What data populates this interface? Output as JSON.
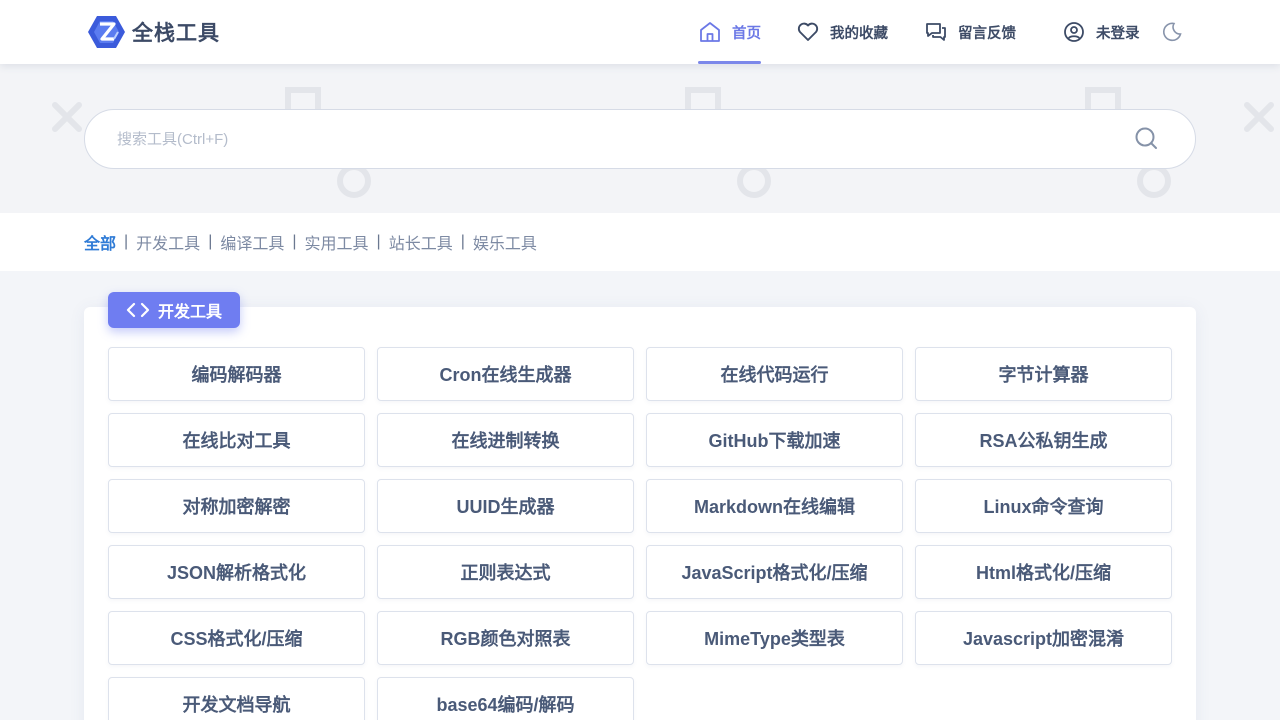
{
  "brand": {
    "name": "全栈工具",
    "logo_icon": "logo-icon",
    "color": "#3b5bdb"
  },
  "nav": {
    "items": [
      {
        "label": "首页",
        "icon": "home-icon",
        "active": true
      },
      {
        "label": "我的收藏",
        "icon": "heart-icon"
      },
      {
        "label": "留言反馈",
        "icon": "chat-icon"
      },
      {
        "label": "未登录",
        "icon": "user-icon"
      }
    ],
    "theme_toggle_icon": "moon-icon"
  },
  "search": {
    "placeholder": "搜索工具(Ctrl+F)",
    "value": ""
  },
  "categories": {
    "items": [
      "全部",
      "开发工具",
      "编译工具",
      "实用工具",
      "站长工具",
      "娱乐工具"
    ],
    "separator": "|",
    "active": "全部"
  },
  "section": {
    "title": "开发工具",
    "icon": "code-icon",
    "tools": [
      "编码解码器",
      "Cron在线生成器",
      "在线代码运行",
      "字节计算器",
      "在线比对工具",
      "在线进制转换",
      "GitHub下载加速",
      "RSA公私钥生成",
      "对称加密解密",
      "UUID生成器",
      "Markdown在线编辑",
      "Linux命令查询",
      "JSON解析格式化",
      "正则表达式",
      "JavaScript格式化/压缩",
      "Html格式化/压缩",
      "CSS格式化/压缩",
      "RGB颜色对照表",
      "MimeType类型表",
      "Javascript加密混淆",
      "开发文档导航",
      "base64编码/解码"
    ]
  },
  "colors": {
    "accent": "#6f7df1",
    "active_category": "#2f7bd6",
    "text": "#4a5a78"
  }
}
